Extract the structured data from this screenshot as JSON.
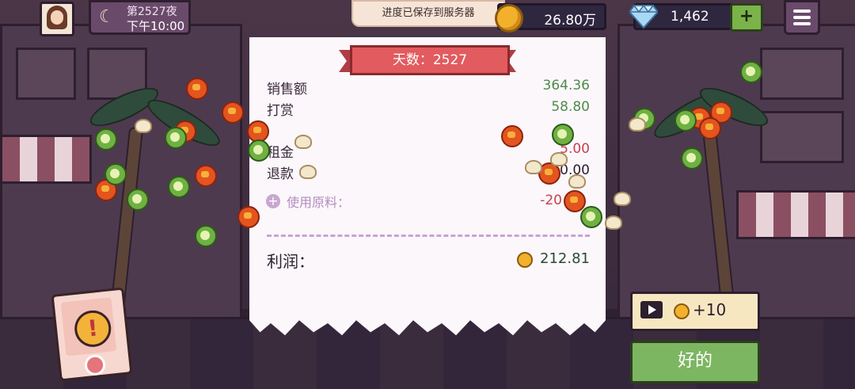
{
  "top_bar": {
    "night_label": "第2527夜",
    "time_label": "下午10:00",
    "toast": "进度已保存到服务器",
    "coins": "26.80万",
    "gems": "1,462",
    "plus_label": "+"
  },
  "receipt": {
    "title": "天数：2527",
    "rows": [
      {
        "label": "销售额",
        "value": "364.36"
      },
      {
        "label": "打赏",
        "value": "58.80"
      },
      {
        "label": "租金",
        "value": "5.00"
      },
      {
        "label": "退款",
        "value": "0.00"
      }
    ],
    "materials_label": "使用原料：",
    "materials_value": "-20",
    "profit_label": "利润：",
    "profit_value": "212.81"
  },
  "buttons": {
    "ad_reward": "+10",
    "ok": "好的"
  },
  "colors": {
    "accent_green": "#7cb661",
    "ribbon_red": "#e25b5f",
    "receipt_bg": "#fbf7fb"
  }
}
